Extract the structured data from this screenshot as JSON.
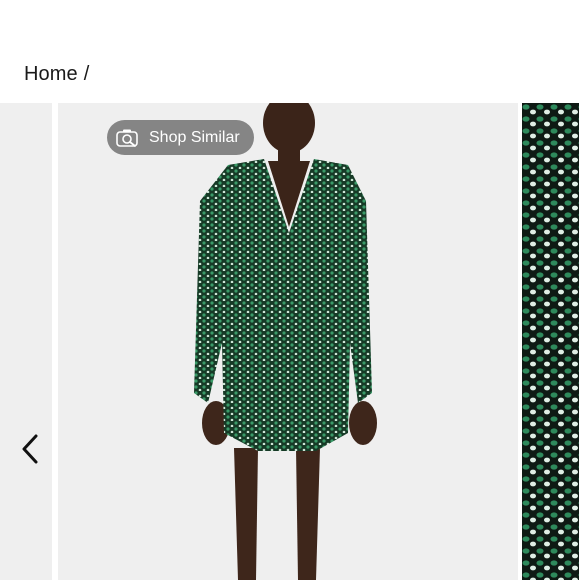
{
  "breadcrumb": {
    "home_label": "Home",
    "separator": "/"
  },
  "gallery": {
    "shop_similar_label": "Shop Similar",
    "colors": {
      "dress": "#1f4d33",
      "sequin": "#2f8a5a",
      "background": "#efefef"
    }
  },
  "icons": {
    "shop_similar": "camera-search-icon",
    "prev": "chevron-left-icon"
  }
}
